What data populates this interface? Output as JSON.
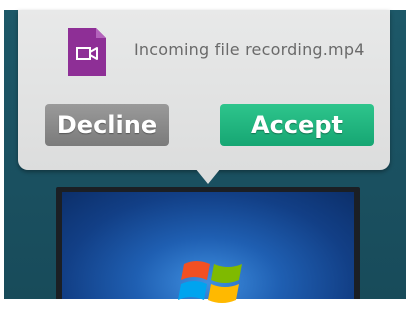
{
  "popover": {
    "file_name": "Incoming file recording.mp4",
    "file_icon": "video-file-icon",
    "decline_label": "Decline",
    "accept_label": "Accept"
  },
  "desktop_preview": {
    "logo_icon": "windows-logo-icon"
  },
  "colors": {
    "accept": "#1fb57e",
    "decline": "#888888",
    "file_icon": "#8e2f96",
    "background": "#1d5868"
  }
}
